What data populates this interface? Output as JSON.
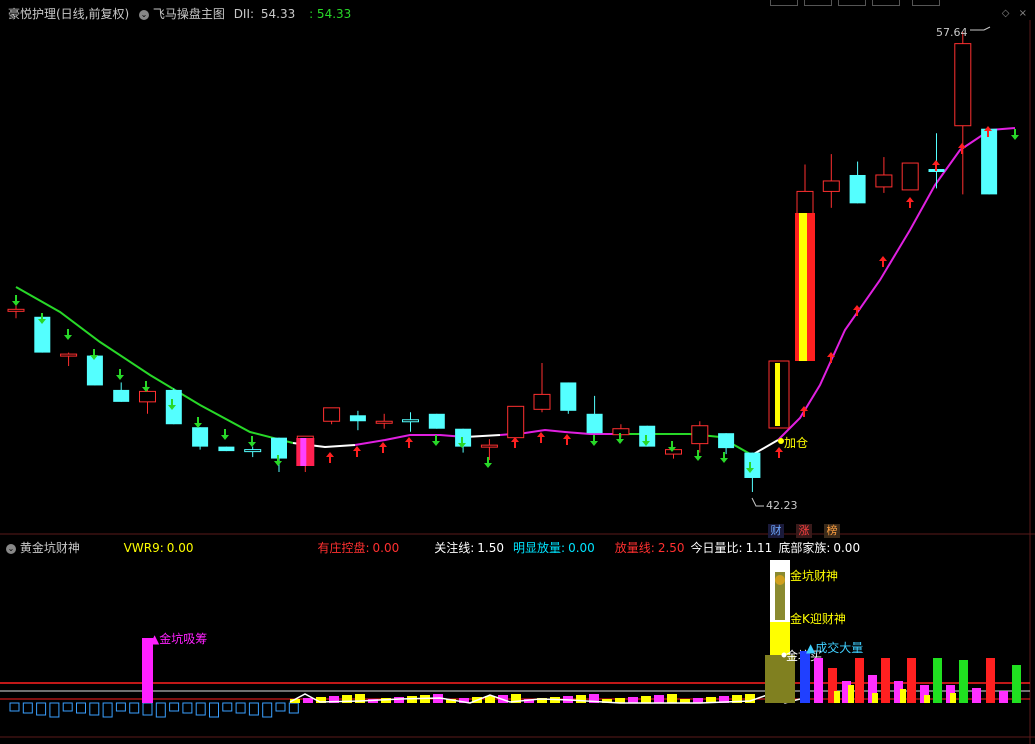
{
  "main_panel": {
    "title": "豪悦护理(日线,前复权)",
    "indicator_name": "飞马操盘主图",
    "indicator_series": "DII:",
    "indicator_value": "54.33",
    "indicator_value2": ": 54.33",
    "high_label": "57.64",
    "low_label": "42.23",
    "add_position_label": "加仓",
    "badges": [
      "财",
      "涨",
      "榜"
    ]
  },
  "sub_panel": {
    "title": "黄金坑财神",
    "fields": [
      {
        "label": "VWR9:",
        "value": "0.00",
        "color": "#ffff00"
      },
      {
        "label": "有庄控盘:",
        "value": "0.00",
        "color": "#ff3030"
      },
      {
        "label": "关注线:",
        "value": "1.50",
        "color": "#ffffff"
      },
      {
        "label": "明显放量:",
        "value": "0.00",
        "color": "#00e5ff"
      },
      {
        "label": "放量线:",
        "value": "2.50",
        "color": "#ff3030"
      },
      {
        "label": "今日量比:",
        "value": "1.11",
        "color": "#ffffff"
      },
      {
        "label": "底部家族:",
        "value": "0.00",
        "color": "#ffffff"
      }
    ],
    "annotations": {
      "pit_accumulate": "▲金坑吸筹",
      "pit_wealth_god": "金坑财神",
      "k_wealth_god": "金K迎财神",
      "pit_buy": "金坑买",
      "big_volume": "▲成交大量"
    }
  },
  "colors": {
    "bull": "#ff3030",
    "bear": "#54ffff",
    "ma_down": "#28d828",
    "ma_flat": "#ffffff",
    "ma_up": "#e020e0",
    "yellow": "#ffff00",
    "magenta": "#ff20ff"
  },
  "chart_data": {
    "type": "candlestick",
    "price_range": [
      42.23,
      57.64
    ],
    "candles": [
      {
        "o": 48.35,
        "c": 48.35,
        "h": 48.55,
        "l": 48.05,
        "dir": "doji"
      },
      {
        "o": 48.1,
        "c": 46.9,
        "h": 48.1,
        "l": 46.9,
        "dir": "down"
      },
      {
        "o": 46.85,
        "c": 46.85,
        "h": 46.9,
        "l": 46.45,
        "dir": "doji"
      },
      {
        "o": 46.8,
        "c": 45.8,
        "h": 46.8,
        "l": 45.8,
        "dir": "down"
      },
      {
        "o": 45.65,
        "c": 45.25,
        "h": 45.9,
        "l": 45.25,
        "dir": "down"
      },
      {
        "o": 45.25,
        "c": 45.6,
        "h": 45.75,
        "l": 44.85,
        "dir": "up"
      },
      {
        "o": 45.65,
        "c": 44.5,
        "h": 45.7,
        "l": 44.5,
        "dir": "down"
      },
      {
        "o": 44.4,
        "c": 43.75,
        "h": 44.4,
        "l": 43.65,
        "dir": "down"
      },
      {
        "o": 43.75,
        "c": 43.6,
        "h": 43.75,
        "l": 43.6,
        "dir": "down"
      },
      {
        "o": 43.6,
        "c": 43.65,
        "h": 43.75,
        "l": 43.4,
        "dir": "doji"
      },
      {
        "o": 44.05,
        "c": 43.35,
        "h": 44.05,
        "l": 42.9,
        "dir": "down"
      },
      {
        "o": 43.4,
        "c": 44.1,
        "h": 44.1,
        "l": 42.9,
        "dir": "up"
      },
      {
        "o": 44.6,
        "c": 45.05,
        "h": 45.05,
        "l": 44.5,
        "dir": "up"
      },
      {
        "o": 44.8,
        "c": 44.6,
        "h": 44.95,
        "l": 44.3,
        "dir": "down"
      },
      {
        "o": 44.6,
        "c": 44.6,
        "h": 44.85,
        "l": 44.35,
        "dir": "doji"
      },
      {
        "o": 44.65,
        "c": 44.65,
        "h": 44.9,
        "l": 44.25,
        "dir": "doji"
      },
      {
        "o": 44.85,
        "c": 44.35,
        "h": 44.85,
        "l": 44.35,
        "dir": "down"
      },
      {
        "o": 44.35,
        "c": 43.75,
        "h": 44.35,
        "l": 43.55,
        "dir": "down"
      },
      {
        "o": 43.8,
        "c": 43.8,
        "h": 44.0,
        "l": 43.3,
        "dir": "doji"
      },
      {
        "o": 44.05,
        "c": 45.1,
        "h": 45.1,
        "l": 43.9,
        "dir": "up"
      },
      {
        "o": 45.0,
        "c": 45.5,
        "h": 46.55,
        "l": 44.9,
        "dir": "up"
      },
      {
        "o": 45.9,
        "c": 44.95,
        "h": 45.9,
        "l": 44.85,
        "dir": "down"
      },
      {
        "o": 44.85,
        "c": 44.2,
        "h": 45.45,
        "l": 44.2,
        "dir": "down"
      },
      {
        "o": 44.35,
        "c": 44.15,
        "h": 44.5,
        "l": 44.05,
        "dir": "up"
      },
      {
        "o": 44.45,
        "c": 43.75,
        "h": 44.45,
        "l": 43.75,
        "dir": "down"
      },
      {
        "o": 43.5,
        "c": 43.65,
        "h": 43.7,
        "l": 43.35,
        "dir": "up"
      },
      {
        "o": 43.85,
        "c": 44.45,
        "h": 44.6,
        "l": 43.55,
        "dir": "up"
      },
      {
        "o": 44.2,
        "c": 43.7,
        "h": 44.2,
        "l": 43.5,
        "dir": "down"
      },
      {
        "o": 43.55,
        "c": 42.7,
        "h": 43.55,
        "l": 42.23,
        "dir": "down"
      },
      {
        "o": 44.45,
        "c": 45.5,
        "h": 45.5,
        "l": 44.45,
        "dir": "up"
      },
      {
        "o": 51.2,
        "c": 52.3,
        "h": 53.2,
        "l": 50.7,
        "dir": "up"
      },
      {
        "o": 52.3,
        "c": 52.65,
        "h": 53.55,
        "l": 51.75,
        "dir": "up"
      },
      {
        "o": 51.9,
        "c": 52.85,
        "h": 53.3,
        "l": 51.9,
        "dir": "down"
      },
      {
        "o": 52.45,
        "c": 52.85,
        "h": 53.45,
        "l": 52.25,
        "dir": "up"
      },
      {
        "o": 52.35,
        "c": 53.25,
        "h": 53.25,
        "l": 52.35,
        "dir": "up"
      },
      {
        "o": 53.05,
        "c": 52.95,
        "h": 54.25,
        "l": 52.4,
        "dir": "down"
      },
      {
        "o": 54.5,
        "c": 57.25,
        "h": 57.64,
        "l": 52.2,
        "dir": "up"
      },
      {
        "o": 54.4,
        "c": 52.2,
        "h": 54.4,
        "l": 52.2,
        "dir": "down"
      }
    ]
  }
}
